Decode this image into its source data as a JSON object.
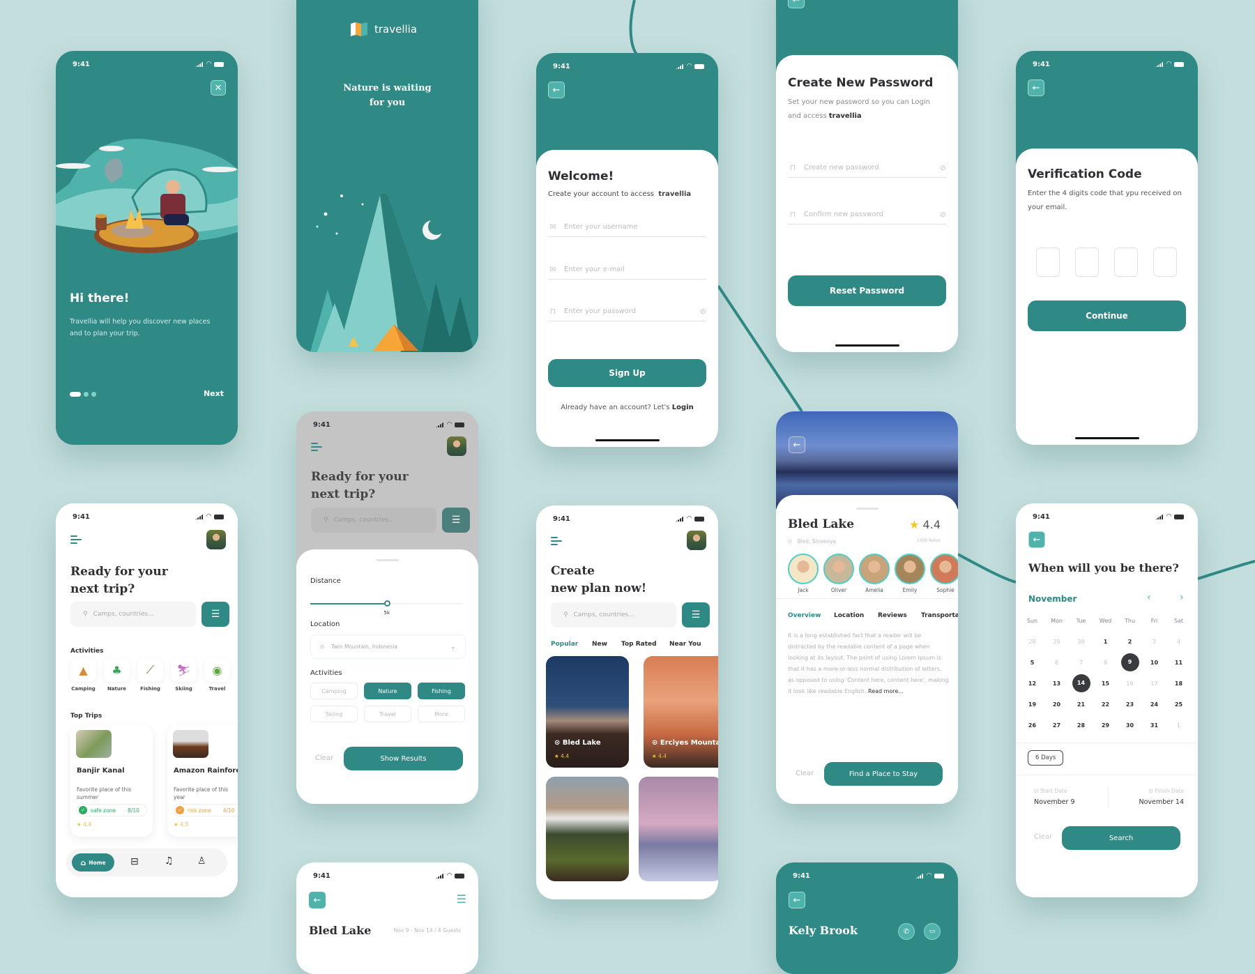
{
  "status_time": "9:41",
  "onboarding": {
    "title": "Hi there!",
    "body": "Travellia will help you discover new places and to plan your trip.",
    "next_label": "Next",
    "page_index": 1,
    "page_count": 3
  },
  "splash": {
    "brand": "travellia",
    "tagline_line1": "Nature is waiting",
    "tagline_line2": "for you"
  },
  "signup": {
    "title": "Welcome!",
    "subtitle": "Create your account to access",
    "brand": "travellia",
    "username_placeholder": "Enter your username",
    "email_placeholder": "Enter your e-mail",
    "password_placeholder": "Enter your password",
    "submit_label": "Sign Up",
    "login_prompt": "Already have an account? Let's",
    "login_link": "Login"
  },
  "new_password": {
    "title": "Create New Password",
    "subtitle": "Set your new password so you can Login and access",
    "brand": "travellia",
    "new_placeholder": "Create new password",
    "confirm_placeholder": "Confirm new password",
    "submit_label": "Reset Password"
  },
  "verification": {
    "title": "Verification Code",
    "subtitle": "Enter the 4 digits code that ypu received on your email.",
    "digits": [
      "",
      "",
      "",
      ""
    ],
    "submit_label": "Continue"
  },
  "home": {
    "title_line1": "Ready for your",
    "title_line2": "next trip?",
    "search_placeholder": "Camps, countries...",
    "activities_label": "Activities",
    "activities": [
      {
        "label": "Camping",
        "icon": "tent-icon"
      },
      {
        "label": "Nature",
        "icon": "tree-icon"
      },
      {
        "label": "Fishing",
        "icon": "fishing-rod-icon"
      },
      {
        "label": "Skiing",
        "icon": "skier-icon"
      },
      {
        "label": "Travel",
        "icon": "backpack-icon"
      }
    ],
    "top_trips_label": "Top Trips",
    "trips": [
      {
        "name": "Banjir Kanal",
        "desc": "Favorite place of this summer",
        "zone": "safe zone",
        "score": "8/10",
        "rating": "4.4",
        "zone_color": "#27ae60"
      },
      {
        "name": "Amazon Rainforest",
        "desc": "Favorite place of this year",
        "zone": "risk zone",
        "score": "4/10",
        "rating": "4.3",
        "zone_color": "#f2a03d"
      }
    ],
    "nav": {
      "home_label": "Home"
    }
  },
  "filter": {
    "title_line1": "Ready for your",
    "title_line2": "next trip?",
    "search_placeholder": "Camps, countries...",
    "distance_label": "Distance",
    "distance_value": "5k",
    "distance_fraction": 0.5,
    "location_label": "Location",
    "location_value": "Twin Mountain, Indonesia",
    "activities_label": "Activities",
    "chips": [
      {
        "label": "Camping",
        "selected": false
      },
      {
        "label": "Nature",
        "selected": true
      },
      {
        "label": "Fishing",
        "selected": true
      },
      {
        "label": "Skiing",
        "selected": false
      },
      {
        "label": "Travel",
        "selected": false
      },
      {
        "label": "More",
        "selected": false
      }
    ],
    "clear_label": "Clear",
    "submit_label": "Show Results"
  },
  "plan": {
    "title_line1": "Create",
    "title_line2": "new plan now!",
    "search_placeholder": "Camps, countries...",
    "tabs": [
      "Popular",
      "New",
      "Top Rated",
      "Near You"
    ],
    "active_tab": "Popular",
    "cards": [
      {
        "name": "Bled Lake",
        "rating": "4.4"
      },
      {
        "name": "Erciyes Mountain",
        "rating": "4.4"
      },
      {
        "name": "",
        "rating": ""
      },
      {
        "name": "",
        "rating": ""
      }
    ]
  },
  "detail": {
    "title": "Bled Lake",
    "location": "Bled, Slovenya",
    "rating": "4.4",
    "rates": "1456 Rates",
    "people": [
      "Jack",
      "Oliver",
      "Amelia",
      "Emily",
      "Sophie"
    ],
    "tabs": [
      "Overview",
      "Location",
      "Reviews",
      "Transportation"
    ],
    "active_tab": "Overview",
    "body": "It is a long established fact that a reader will be distracted by the readable content of a page when looking at its layout. The point of using Lorem Ipsum is that it has a more-or-less normal distribution of letters, as opposed to using 'Content here, content here', making it look like readable English.",
    "read_more": "Read more...",
    "clear_label": "Clear",
    "submit_label": "Find a Place to Stay"
  },
  "calendar": {
    "title": "When will you be there?",
    "month": "November",
    "weekdays": [
      "Sun",
      "Mon",
      "Tue",
      "Wed",
      "Thu",
      "Fri",
      "Sat"
    ],
    "weeks": [
      [
        {
          "d": "28",
          "dim": true
        },
        {
          "d": "29",
          "dim": true
        },
        {
          "d": "30",
          "dim": true
        },
        {
          "d": "1"
        },
        {
          "d": "2"
        },
        {
          "d": "3",
          "dim": true
        },
        {
          "d": "4",
          "dim": true
        }
      ],
      [
        {
          "d": "5"
        },
        {
          "d": "6",
          "dim": true
        },
        {
          "d": "7",
          "dim": true
        },
        {
          "d": "8",
          "dim": true
        },
        {
          "d": "9",
          "sel": true
        },
        {
          "d": "10"
        },
        {
          "d": "11"
        }
      ],
      [
        {
          "d": "12"
        },
        {
          "d": "13"
        },
        {
          "d": "14",
          "sel": true
        },
        {
          "d": "15"
        },
        {
          "d": "16",
          "dim": true
        },
        {
          "d": "17",
          "dim": true
        },
        {
          "d": "18"
        }
      ],
      [
        {
          "d": "19"
        },
        {
          "d": "20"
        },
        {
          "d": "21"
        },
        {
          "d": "22"
        },
        {
          "d": "23"
        },
        {
          "d": "24"
        },
        {
          "d": "25"
        }
      ],
      [
        {
          "d": "26"
        },
        {
          "d": "27"
        },
        {
          "d": "28"
        },
        {
          "d": "29"
        },
        {
          "d": "30"
        },
        {
          "d": "31"
        },
        {
          "d": "1",
          "dim": true
        }
      ]
    ],
    "duration": "6 Days",
    "start_label": "Start Date",
    "start_value": "November 9",
    "finish_label": "Finish Date",
    "finish_value": "November 14",
    "clear_label": "Clear",
    "submit_label": "Search"
  },
  "booking": {
    "title": "Bled Lake",
    "summary": "Nov 9 - Nov 14 / 4 Guests"
  },
  "chat": {
    "name": "Kely Brook"
  },
  "colors": {
    "primary": "#2f8a85",
    "accent": "#4fb3ac",
    "background": "#c3dedd",
    "star": "#f5c518"
  }
}
